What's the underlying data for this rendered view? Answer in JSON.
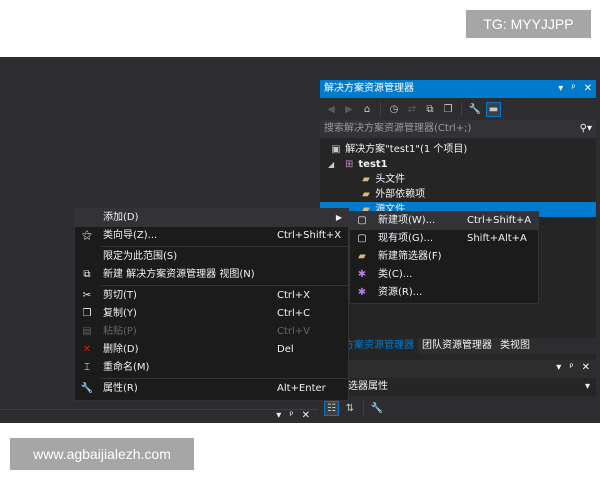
{
  "watermarks": {
    "top": "TG: MYYJJPP",
    "bottom": "www.agbaijialezh.com"
  },
  "solution_explorer": {
    "title": "解决方案资源管理器",
    "title_buttons": [
      "▾",
      "ᵖ",
      "✕"
    ],
    "search_placeholder": "搜索解决方案资源管理器(Ctrl+;)",
    "tree": [
      {
        "label": "解决方案\"test1\"(1 个项目)",
        "icon": "solution-icon",
        "indent": 0,
        "expander": ""
      },
      {
        "label": "test1",
        "icon": "project-icon",
        "indent": 1,
        "expander": "◢"
      },
      {
        "label": "头文件",
        "icon": "folder-icon",
        "indent": 2,
        "expander": ""
      },
      {
        "label": "外部依赖项",
        "icon": "folder-icon",
        "indent": 2,
        "expander": ""
      },
      {
        "label": "源文件",
        "icon": "folder-icon",
        "indent": 2,
        "expander": "",
        "selected": true
      }
    ],
    "tabs": [
      "解决方案资源管理器",
      "团队资源管理器",
      "类视图"
    ]
  },
  "properties": {
    "title_buttons": [
      "▾",
      "ᵖ",
      "✕"
    ],
    "subtitle": "筛选器属性"
  },
  "bottom_panel": {
    "buttons": [
      "▾",
      "ᵖ",
      "✕"
    ]
  },
  "context_menu": {
    "items": [
      {
        "icon": "",
        "label": "添加(D)",
        "shortcut": "",
        "submenu": true,
        "hover": true
      },
      {
        "icon": "class-wizard-icon",
        "label": "类向导(Z)...",
        "shortcut": "Ctrl+Shift+X"
      },
      {
        "sep": true
      },
      {
        "icon": "",
        "label": "限定为此范围(S)",
        "shortcut": ""
      },
      {
        "icon": "new-view-icon",
        "label": "新建 解决方案资源管理器 视图(N)",
        "shortcut": ""
      },
      {
        "sep": true
      },
      {
        "icon": "cut-icon",
        "label": "剪切(T)",
        "shortcut": "Ctrl+X"
      },
      {
        "icon": "copy-icon",
        "label": "复制(Y)",
        "shortcut": "Ctrl+C"
      },
      {
        "icon": "paste-icon",
        "label": "粘贴(P)",
        "shortcut": "Ctrl+V",
        "disabled": true
      },
      {
        "icon": "delete-icon",
        "label": "删除(D)",
        "shortcut": "Del"
      },
      {
        "icon": "rename-icon",
        "label": "重命名(M)",
        "shortcut": ""
      },
      {
        "sep": true
      },
      {
        "icon": "properties-icon",
        "label": "属性(R)",
        "shortcut": "Alt+Enter"
      }
    ]
  },
  "submenu": {
    "items": [
      {
        "icon": "new-item-icon",
        "label": "新建项(W)...",
        "shortcut": "Ctrl+Shift+A",
        "hover": true
      },
      {
        "icon": "existing-item-icon",
        "label": "现有项(G)...",
        "shortcut": "Shift+Alt+A"
      },
      {
        "icon": "new-filter-icon",
        "label": "新建筛选器(F)",
        "shortcut": ""
      },
      {
        "icon": "class-icon",
        "label": "类(C)...",
        "shortcut": ""
      },
      {
        "icon": "resource-icon",
        "label": "资源(R)...",
        "shortcut": ""
      }
    ]
  },
  "colors": {
    "accent": "#007acc",
    "background": "#2d2d30",
    "menu_bg": "#1b1b1c",
    "delete": "#e51400"
  }
}
